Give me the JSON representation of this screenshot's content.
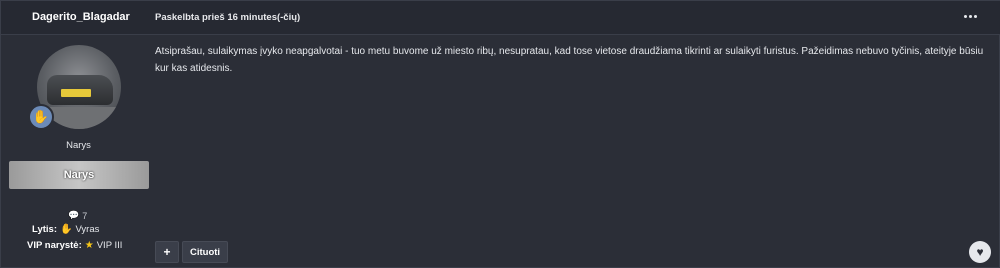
{
  "header": {
    "author_name": "Dagerito_Blagadar",
    "posted_time": "Paskelbta prieš 16 minutes(-čių)"
  },
  "author": {
    "avatar_icon": "user-avatar-car",
    "rank_badge_icon": "handshake-icon",
    "rank": "Narys",
    "group": "Narys",
    "posts_count_icon": "comment-icon",
    "posts_count": "7",
    "gender_label": "Lytis:",
    "gender_icon": "hand-emoji-icon",
    "gender_value": "Vyras",
    "vip_label": "VIP narystė:",
    "vip_icon": "star-icon",
    "vip_value": "VIP III"
  },
  "post": {
    "body": "Atsiprašau, sulaikymas įvyko neapgalvotai - tuo metu buvome už miesto ribų, nesupratau, kad tose vietose draudžiama tikrinti ar sulaikyti furistus. Pažeidimas nebuvo tyčinis, ateityje būsiu kur kas atidesnis."
  },
  "actions": {
    "plus_label": "+",
    "quote_label": "Cituoti",
    "like_icon": "heart-icon"
  },
  "colors": {
    "background": "#2b2e37",
    "header_bg": "#262932",
    "accent": "#6c8bb8",
    "star": "#f5c518"
  }
}
